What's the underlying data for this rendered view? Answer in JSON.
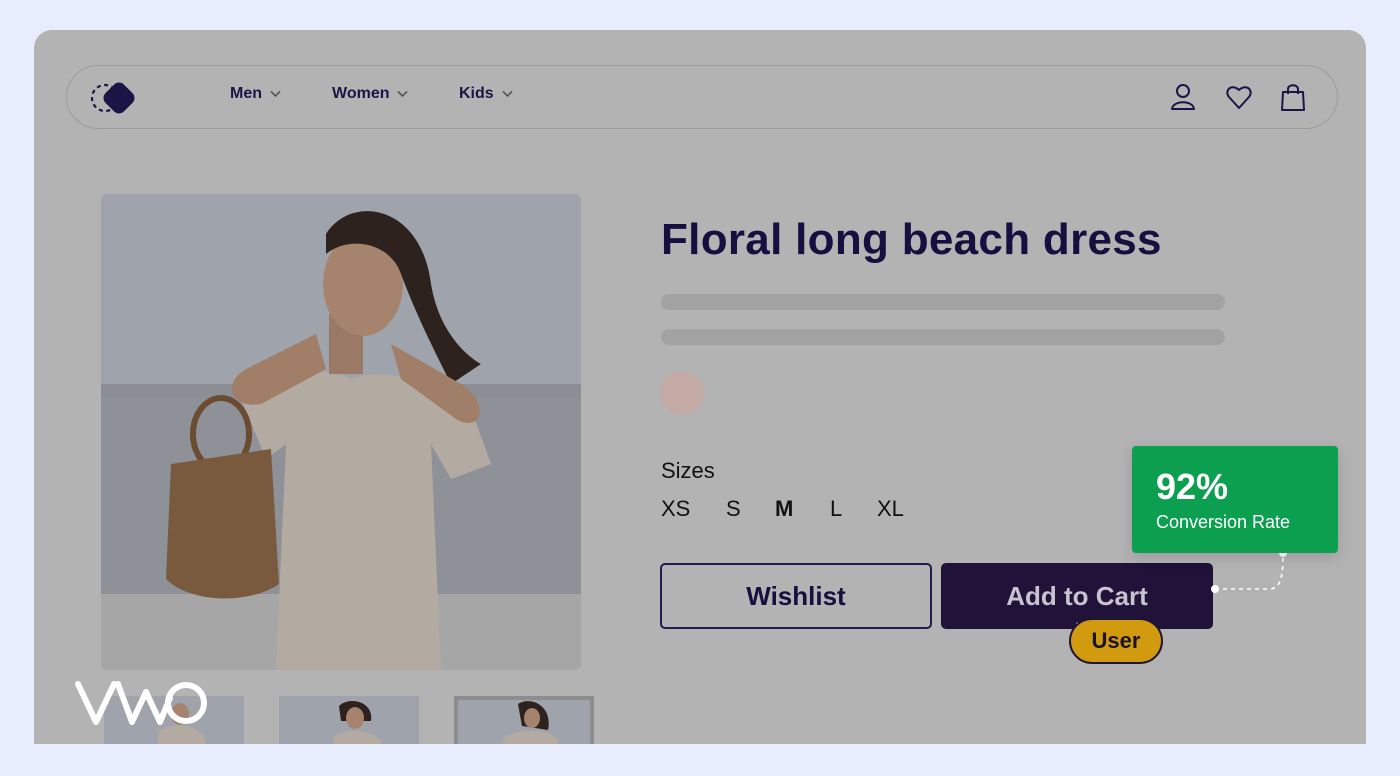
{
  "nav": {
    "items": [
      {
        "label": "Men"
      },
      {
        "label": "Women"
      },
      {
        "label": "Kids"
      }
    ],
    "icons": [
      "user-icon",
      "heart-icon",
      "bag-icon"
    ]
  },
  "product": {
    "title": "Floral long beach dress",
    "swatch_color": "#c4aaa4",
    "sizes_label": "Sizes",
    "sizes": [
      "XS",
      "S",
      "M",
      "L",
      "XL"
    ],
    "selected_size": "M",
    "wishlist_label": "Wishlist",
    "cart_label": "Add to Cart"
  },
  "cursor": {
    "badge": "User"
  },
  "metric": {
    "value": "92%",
    "label": "Conversion Rate"
  },
  "colors": {
    "background": "#e8edfe",
    "overlay": "#b3b3b3",
    "primary_dark": "#201239",
    "success_green": "#0d9f50",
    "badge_yellow": "#d19a0f"
  }
}
